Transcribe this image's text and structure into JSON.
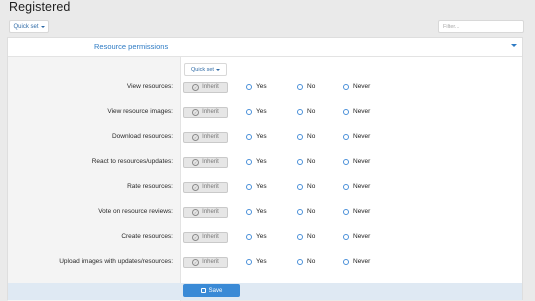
{
  "page": {
    "title": "Registered"
  },
  "toolbar": {
    "quickset_label": "Quick set",
    "filter_placeholder": "Filter..."
  },
  "panel": {
    "title": "Resource permissions",
    "quickset_label": "Quick set",
    "inherit_label": "Inherit",
    "options": [
      "Yes",
      "No",
      "Never"
    ],
    "rows": [
      {
        "label": "View resources:"
      },
      {
        "label": "View resource images:"
      },
      {
        "label": "Download resources:"
      },
      {
        "label": "React to resources/updates:"
      },
      {
        "label": "Rate resources:"
      },
      {
        "label": "Vote on resource reviews:"
      },
      {
        "label": "Create resources:"
      },
      {
        "label": "Upload images with updates/resources:"
      }
    ]
  },
  "footer": {
    "save_label": "Save"
  },
  "colors": {
    "accent": "#2e7bc4",
    "save": "#3a8ad6",
    "radio": "#4a90d9"
  }
}
